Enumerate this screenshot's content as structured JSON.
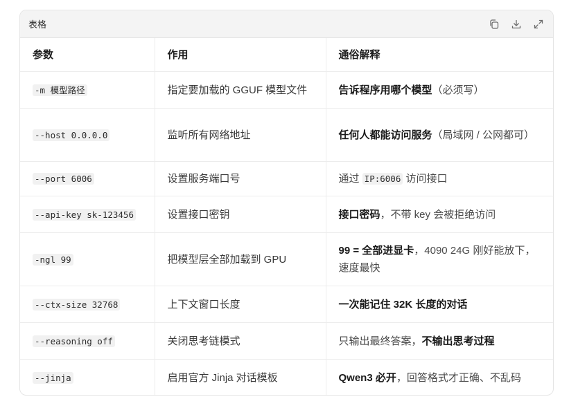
{
  "panel": {
    "title": "表格",
    "icons": [
      "copy-icon",
      "download-icon",
      "expand-icon"
    ]
  },
  "table": {
    "headers": [
      "参数",
      "作用",
      "通俗解释"
    ],
    "rows": [
      {
        "param": "-m 模型路径",
        "purpose": "指定要加载的 GGUF 模型文件",
        "explain_bold": "告诉程序用哪个模型",
        "explain_rest": "（必须写）"
      },
      {
        "param": "--host 0.0.0.0",
        "purpose": "监听所有网络地址",
        "explain_bold": "任何人都能访问服务",
        "explain_rest": "（局域网 / 公网都可）"
      },
      {
        "param": "--port 6006",
        "purpose": "设置服务端口号",
        "explain_pre": "通过 ",
        "explain_code": "IP:6006",
        "explain_post": " 访问接口"
      },
      {
        "param": "--api-key sk-123456",
        "purpose": "设置接口密钥",
        "explain_bold": "接口密码",
        "explain_rest": "，不带 key 会被拒绝访问"
      },
      {
        "param": "-ngl 99",
        "purpose": "把模型层全部加载到 GPU",
        "explain_bold": "99 = 全部进显卡",
        "explain_rest": "，4090 24G 刚好能放下，速度最快"
      },
      {
        "param": "--ctx-size 32768",
        "purpose": "上下文窗口长度",
        "explain_bold": "一次能记住 32K 长度的对话",
        "explain_rest": ""
      },
      {
        "param": "--reasoning off",
        "purpose": "关闭思考链模式",
        "explain_pre": "只输出最终答案，",
        "explain_bold": "不输出思考过程"
      },
      {
        "param": "--jinja",
        "purpose": "启用官方 Jinja 对话模板",
        "explain_bold": "Qwen3 必开",
        "explain_rest": "，回答格式才正确、不乱码"
      }
    ]
  }
}
